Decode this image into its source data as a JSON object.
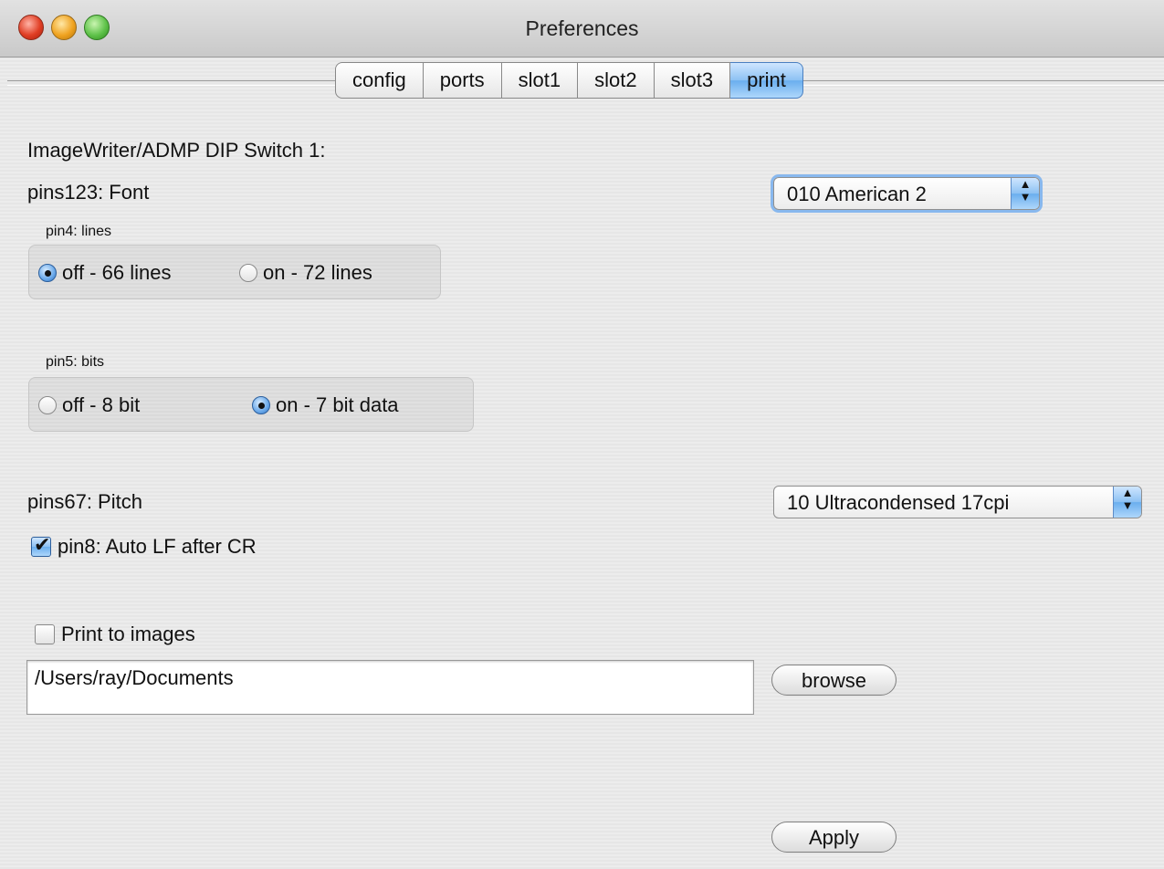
{
  "window": {
    "title": "Preferences"
  },
  "tabs": [
    {
      "label": "config",
      "active": false
    },
    {
      "label": "ports",
      "active": false
    },
    {
      "label": "slot1",
      "active": false
    },
    {
      "label": "slot2",
      "active": false
    },
    {
      "label": "slot3",
      "active": false
    },
    {
      "label": "print",
      "active": true
    }
  ],
  "section_title": "ImageWriter/ADMP DIP Switch 1:",
  "font": {
    "label": "pins123: Font",
    "selected": "010 American 2"
  },
  "pin4": {
    "label": "pin4: lines",
    "options": [
      {
        "label": "off - 66 lines",
        "selected": true
      },
      {
        "label": "on - 72 lines",
        "selected": false
      }
    ]
  },
  "pin5": {
    "label": "pin5: bits",
    "options": [
      {
        "label": "off - 8 bit",
        "selected": false
      },
      {
        "label": "on - 7 bit data",
        "selected": true
      }
    ]
  },
  "pitch": {
    "label": "pins67: Pitch",
    "selected": "10 Ultracondensed 17cpi"
  },
  "pin8": {
    "label": "pin8: Auto LF after CR",
    "checked": true
  },
  "print_to_images": {
    "label": "Print to images",
    "checked": false
  },
  "path_field": {
    "value": "/Users/ray/Documents"
  },
  "buttons": {
    "browse": "browse",
    "apply": "Apply"
  },
  "colors": {
    "accent": "#6aaeee",
    "background": "#e8e8e8"
  }
}
